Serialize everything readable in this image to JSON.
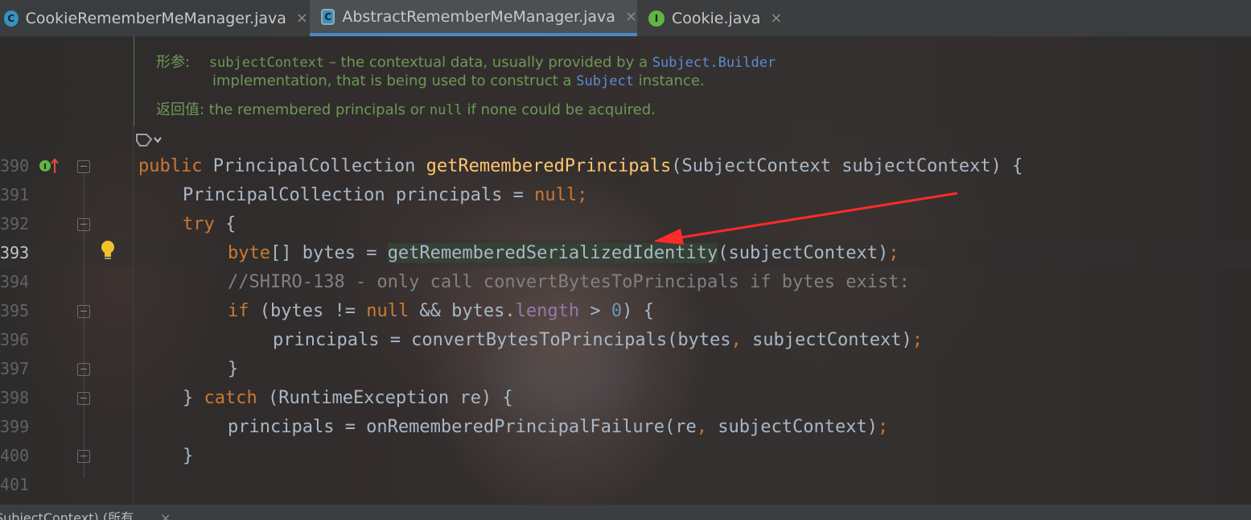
{
  "tabs": [
    {
      "label": "CookieRememberMeManager.java",
      "icon": "class-icon",
      "active": false,
      "close": "×"
    },
    {
      "label": "AbstractRememberMeManager.java",
      "icon": "abstract-class-icon",
      "active": true,
      "close": "×"
    },
    {
      "label": "Cookie.java",
      "icon": "interface-icon",
      "active": false,
      "close": "×"
    }
  ],
  "doc": {
    "params_label": "形参:",
    "params_name": "subjectContext",
    "params_text_1": " – the contextual data, usually provided by a ",
    "params_link_1": "Subject.Builder",
    "params_text_2": "implementation, that is being used to construct a ",
    "params_link_2": "Subject",
    "params_text_3": " instance.",
    "returns_label": "返回值:",
    "returns_text_1": " the remembered principals or ",
    "returns_code": "null",
    "returns_text_2": " if none could be acquired."
  },
  "line_numbers": [
    "390",
    "391",
    "392",
    "393",
    "394",
    "395",
    "396",
    "397",
    "398",
    "399",
    "400",
    "401"
  ],
  "current_line": "393",
  "code": {
    "l390": {
      "kw": "public ",
      "t1": "PrincipalCollection ",
      "fn": "getRememberedPrincipals",
      "t2": "(SubjectContext subjectContext) {"
    },
    "l391": {
      "t1": "PrincipalCollection principals = ",
      "kw": "null",
      "t2": ";"
    },
    "l392": {
      "kw": "try",
      "t1": " {"
    },
    "l393": {
      "kw": "byte",
      "t1": "[] bytes = ",
      "hl": "getRememberedSerializedIdentity",
      "t2": "(subjectContext)",
      "semi": ";"
    },
    "l394": {
      "cm": "//SHIRO-138 - only call convertBytesToPrincipals if bytes exist:"
    },
    "l395": {
      "kw": "if",
      "t1": " (bytes != ",
      "kw2": "null",
      "t2": " && bytes.",
      "fld": "length",
      "t3": " > ",
      "num": "0",
      "t4": ") {"
    },
    "l396": {
      "t1": "principals = convertBytesToPrincipals(bytes",
      "comma": ",",
      "t2": " subjectContext)",
      "semi": ";"
    },
    "l397": {
      "t1": "}"
    },
    "l398": {
      "t1": "} ",
      "kw": "catch",
      "t2": " (RuntimeException re) {"
    },
    "l399": {
      "t1": "principals = onRememberedPrincipalFailure(re",
      "comma": ",",
      "t2": " subjectContext)",
      "semi": ";"
    },
    "l400": {
      "t1": "}"
    }
  },
  "bottom_bar": {
    "text": "SubjectContext) (所有",
    "close": "×"
  },
  "colors": {
    "keyword": "#cc7832",
    "function": "#ffc66d",
    "comment": "#808080",
    "doc": "#6a9955",
    "annotation_arrow": "#ff2a2a"
  }
}
